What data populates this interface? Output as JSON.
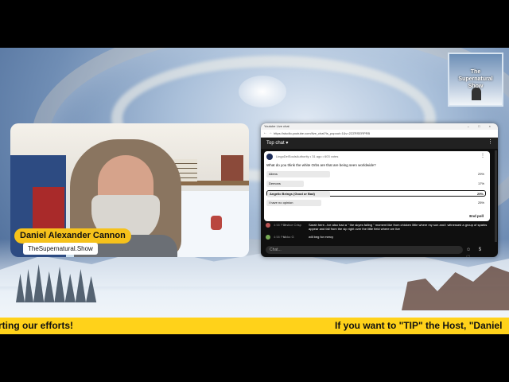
{
  "logo": {
    "line1": "The",
    "line2": "Supernatural",
    "line3": "Show"
  },
  "host": {
    "name": "Daniel Alexander Cannon",
    "site": "TheSupernatural.Show"
  },
  "browser": {
    "window_title": "Youtube Live chat",
    "window_controls": "– □ ×",
    "nav": "← →",
    "url": "https://studio.youtube.com/live_chat?is_popout=1&v=2ZZRSERPRB"
  },
  "chat": {
    "header": "Top chat ▾",
    "placeholder": "Chat...",
    "icons": "☺ $ ♡"
  },
  "poll": {
    "meta": "LingoDelSoulsAuthority • 31 ago • 603 votes",
    "question": "What do you think the white Orbs are that are being seen worldwide?",
    "options": [
      {
        "label": "Aliens",
        "percent": "29%",
        "value": 0.29
      },
      {
        "label": "Demons",
        "percent": "17%",
        "value": 0.17
      },
      {
        "label": "Angelic Beings (Good or Bad)",
        "percent": "29%",
        "value": 0.29
      },
      {
        "label": "I have no opinion",
        "percent": "25%",
        "value": 0.25
      }
    ],
    "end_label": "End poll"
  },
  "messages": [
    {
      "time": "4:58 PM",
      "author": "Jestice Crisp",
      "text": "Sarah here...Ive also had a \" the skyes falling \" moment like from chicken little where my son and I witnessed a group of sparks appear and fall from the sip right over the little field where we live"
    },
    {
      "time": "4:58 PM",
      "author": "nicko G",
      "text": "will beg for mercy"
    }
  ],
  "ticker": {
    "left_text": "rting our efforts!",
    "right_text": "If you want to \"TIP\" the Host, \"Daniel"
  },
  "colors": {
    "accent_yellow": "#f6c21b",
    "ticker_yellow": "#ffd21a",
    "chat_bg": "#0f0f0f"
  }
}
